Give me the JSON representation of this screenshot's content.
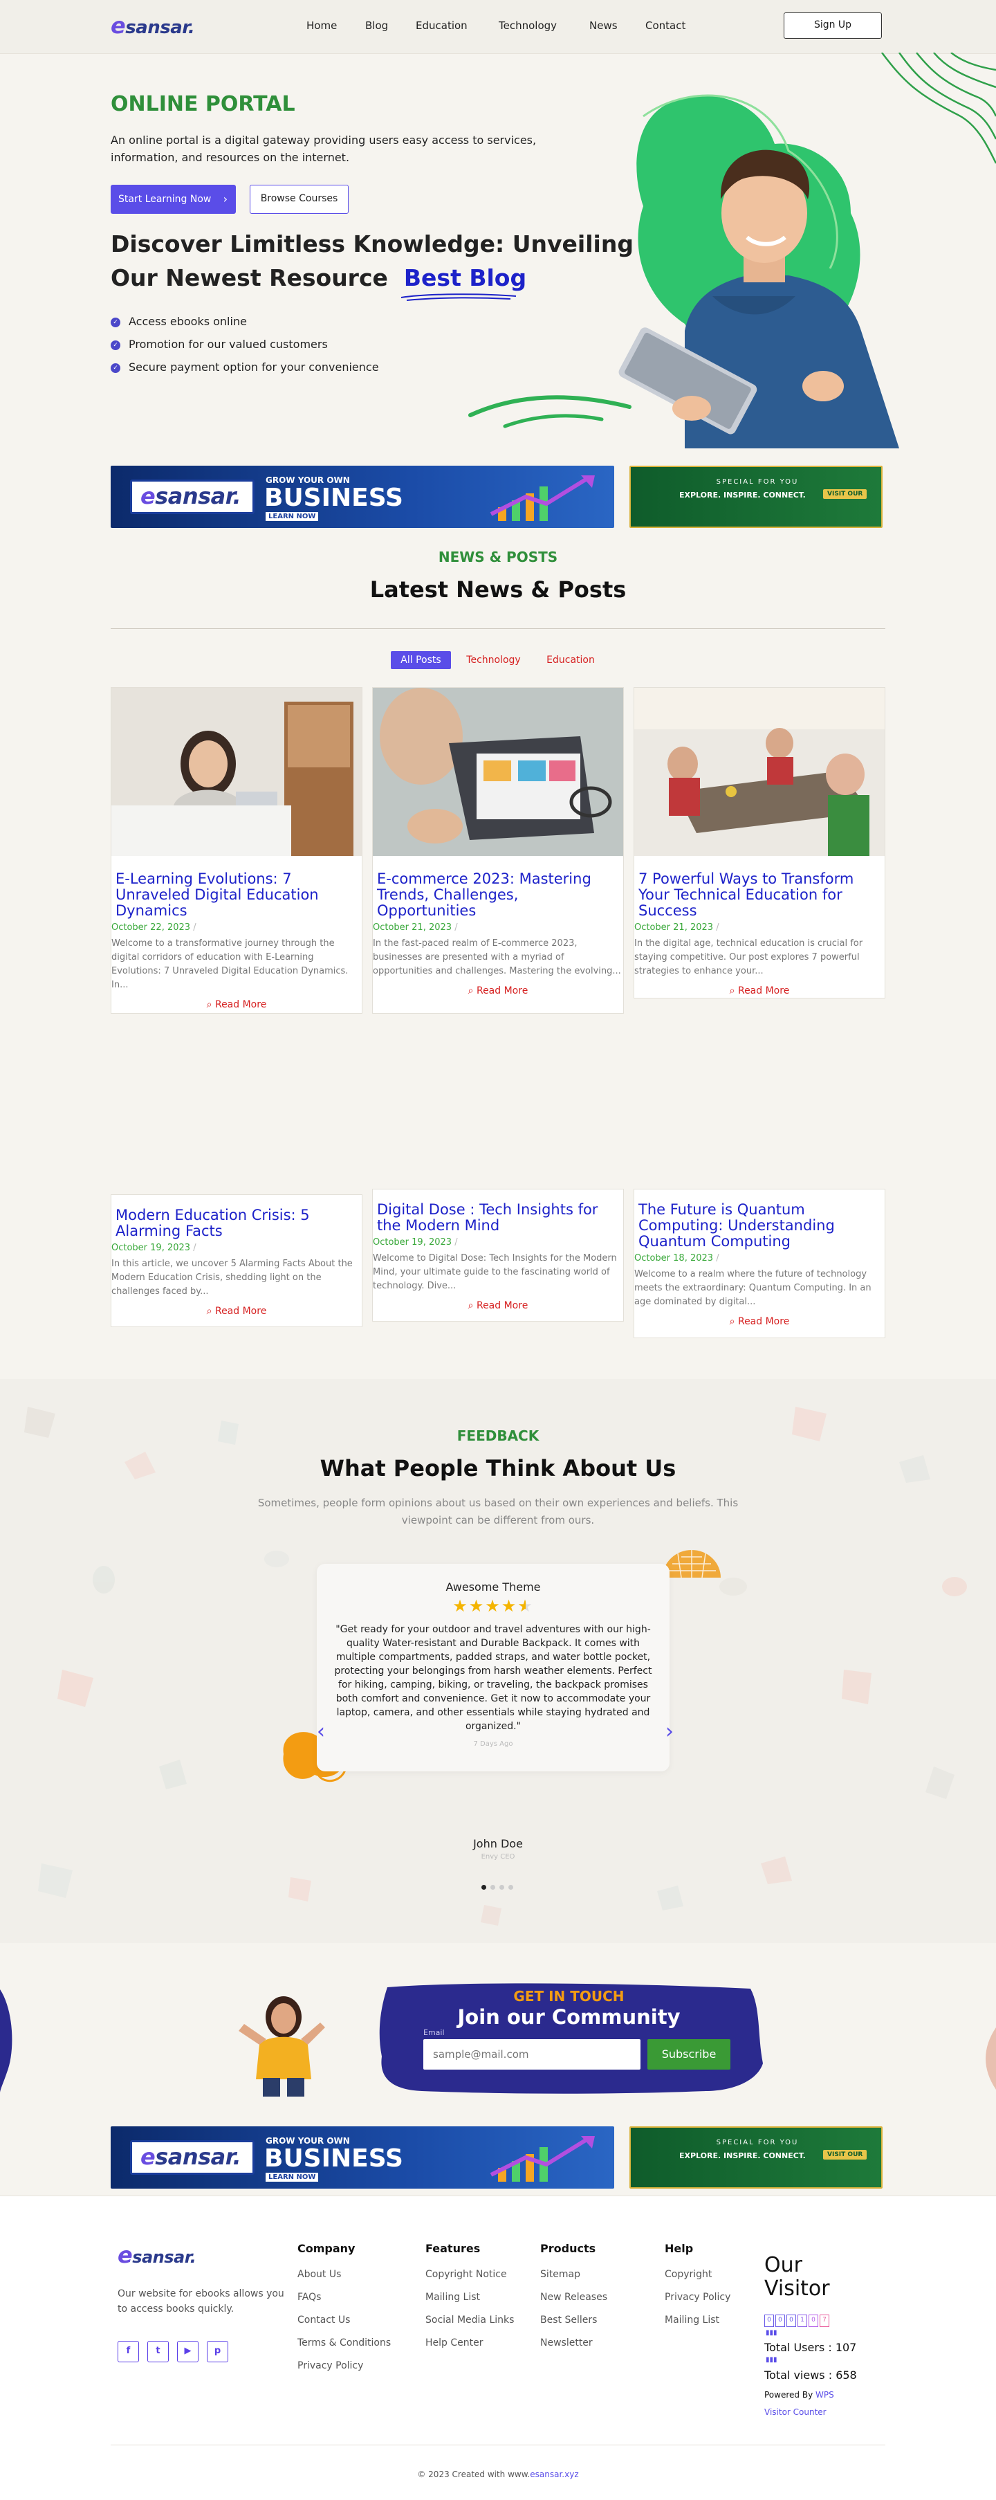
{
  "header": {
    "logo_e": "e",
    "logo_rest": "sansar.",
    "nav": [
      "Home",
      "Blog",
      "Education",
      "Technology",
      "News",
      "Contact"
    ],
    "signup": "Sign Up"
  },
  "hero": {
    "title": "ONLINE PORTAL",
    "desc": "An online portal is a digital gateway providing users easy access to services, information, and resources on the internet.",
    "btn_primary": "Start Learning Now",
    "btn_secondary": "Browse Courses",
    "heading_line1": "Discover Limitless Knowledge: Unveiling",
    "heading_line2": "Our Newest Resource",
    "heading_highlight": "Best Blog",
    "bullets": [
      "Access ebooks online",
      "Promotion for our valued customers",
      "Secure payment option for your convenience"
    ]
  },
  "banners": {
    "big": {
      "logo_e": "e",
      "logo_rest": "sansar.",
      "grow": "GROW YOUR OWN",
      "business": "BUSINESS",
      "learn": "LEARN NOW"
    },
    "small": {
      "special": "SPECIAL FOR YOU",
      "tagline": "EXPLORE. INSPIRE. CONNECT.",
      "visit": "VISIT OUR"
    }
  },
  "news": {
    "eyebrow": "NEWS & POSTS",
    "title": "Latest News & Posts",
    "filters": [
      "All Posts",
      "Technology",
      "Education"
    ],
    "read_more": "Read More",
    "posts": [
      {
        "title": "E-Learning Evolutions: 7 Unraveled Digital Education Dynamics",
        "date": "October 22, 2023",
        "excerpt": "Welcome to a transformative journey through the digital corridors of education with E-Learning Evolutions: 7 Unraveled Digital Education Dynamics. In..."
      },
      {
        "title": "E-commerce 2023: Mastering Trends, Challenges, Opportunities",
        "date": "October 21, 2023",
        "excerpt": "In the fast-paced realm of E-commerce 2023, businesses are presented with a myriad of opportunities and challenges. Mastering the evolving..."
      },
      {
        "title": "7 Powerful Ways to Transform Your Technical Education for Success",
        "date": "October 21, 2023",
        "excerpt": "In the digital age, technical education is crucial for staying competitive. Our post explores 7 powerful strategies to enhance your..."
      },
      {
        "title": "Modern Education Crisis: 5 Alarming Facts",
        "date": "October 19, 2023",
        "excerpt": "In this article, we uncover 5 Alarming Facts About the Modern Education Crisis, shedding light on the challenges faced by..."
      },
      {
        "title": "Digital Dose : Tech Insights for the Modern Mind",
        "date": "October 19, 2023",
        "excerpt": "Welcome to Digital Dose: Tech Insights for the Modern Mind, your ultimate guide to the fascinating world of technology. Dive..."
      },
      {
        "title": "The Future is Quantum Computing: Understanding Quantum Computing",
        "date": "October 18, 2023",
        "excerpt": "Welcome to a realm where the future of technology meets the extraordinary: Quantum Computing. In an age dominated by digital..."
      }
    ]
  },
  "feedback": {
    "eyebrow": "FEEDBACK",
    "title": "What People Think About Us",
    "subtitle": "Sometimes, people form opinions about us based on their own experiences and beliefs. This viewpoint can be different from ours.",
    "card_title": "Awesome Theme",
    "rating": 4.5,
    "quote": "\"Get ready for your outdoor and travel adventures with our high-quality Water-resistant and Durable Backpack. It comes with multiple compartments, padded straps, and water bottle pocket, protecting your belongings from harsh weather elements. Perfect for hiking, camping, biking, or traveling, the backpack promises both comfort and convenience. Get it now to accommodate your laptop, camera, and other essentials while staying hydrated and organized.\"",
    "time": "7 Days Ago",
    "author": "John Doe",
    "role": "Envy CEO"
  },
  "community": {
    "eyebrow": "GET IN TOUCH",
    "title": "Join our Community",
    "email_label": "Email",
    "placeholder": "sample@mail.com",
    "button": "Subscribe"
  },
  "footer": {
    "about": "Our website for ebooks allows you to access books quickly.",
    "socials": [
      "f",
      "t",
      "▶",
      "p"
    ],
    "columns": [
      {
        "title": "Company",
        "links": [
          "About Us",
          "FAQs",
          "Contact Us",
          "Terms & Conditions",
          "Privacy Policy"
        ]
      },
      {
        "title": "Features",
        "links": [
          "Copyright Notice",
          "Mailing List",
          "Social Media Links",
          "Help Center"
        ]
      },
      {
        "title": "Products",
        "links": [
          "Sitemap",
          "New Releases",
          "Best Sellers",
          "Newsletter"
        ]
      },
      {
        "title": "Help",
        "links": [
          "Copyright",
          "Privacy Policy",
          "Mailing List"
        ]
      }
    ],
    "visitor_title_1": "Our",
    "visitor_title_2": "Visitor",
    "counter_digits": [
      "0",
      "0",
      "0",
      "1",
      "0",
      "7"
    ],
    "total_users": "Total Users : 107",
    "total_views": "Total views : 658",
    "powered_by": "Powered By",
    "powered_link": "WPS",
    "visitor_counter": "Visitor Counter",
    "copyright_prefix": "© 2023 Created with www.",
    "copyright_link": "esansar.xyz"
  },
  "colors": {
    "primary": "#5a4de8",
    "green": "#2f8f3a",
    "link_blue": "#1d22c9",
    "red": "#d62121",
    "navy": "#2b2a8e"
  }
}
